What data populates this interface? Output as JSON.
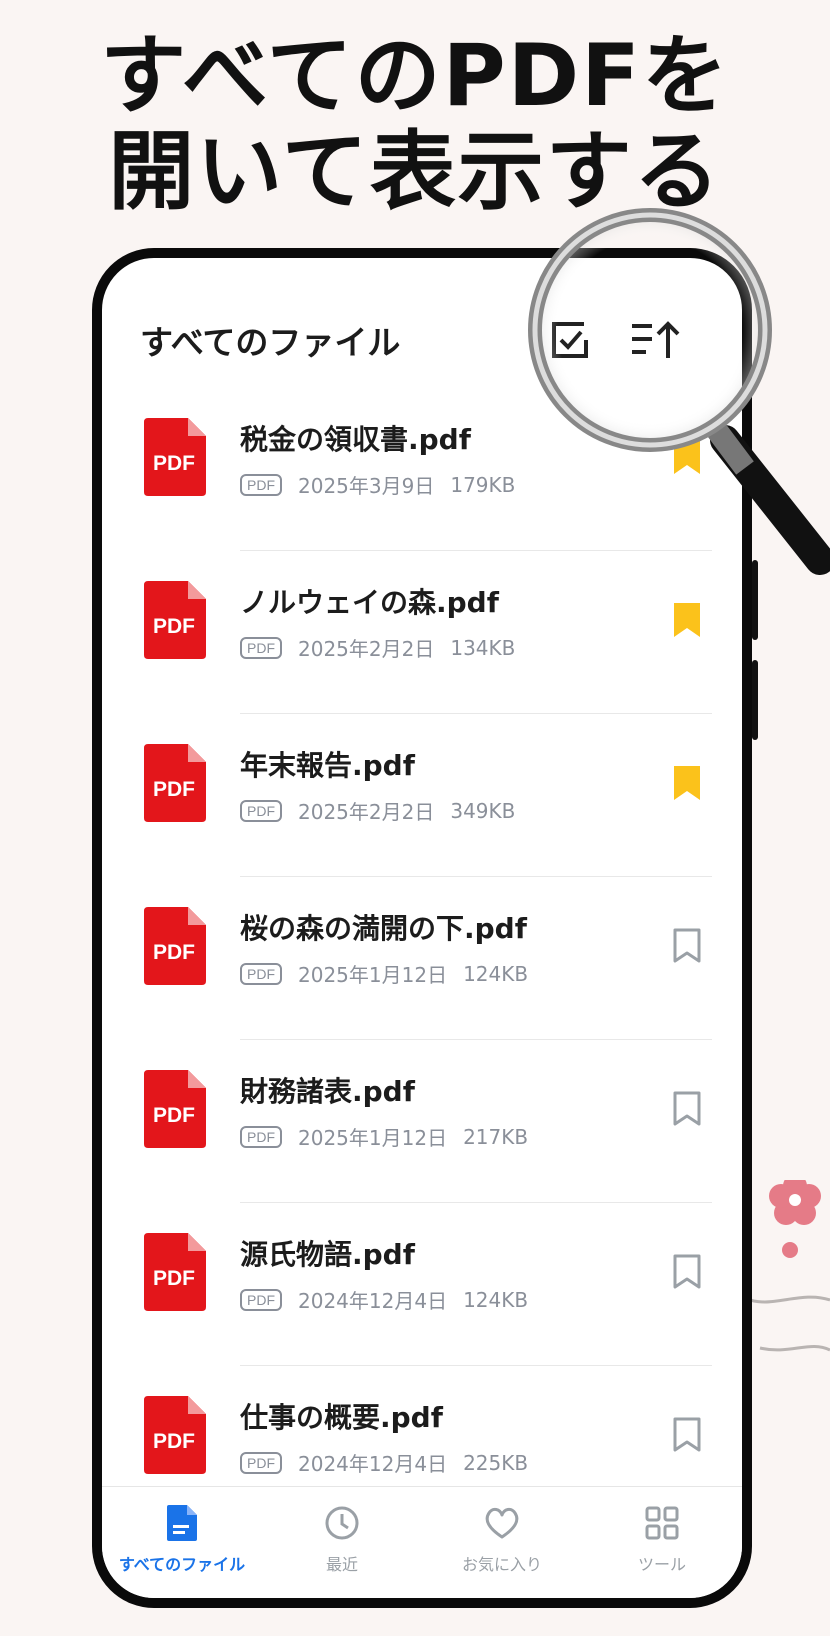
{
  "headline": {
    "line1": "すべてのPDFを",
    "line2": "開いて表示する"
  },
  "header": {
    "title": "すべてのファイル",
    "select_icon": "checkbox-select-icon",
    "sort_icon": "sort-ascending-icon"
  },
  "colors": {
    "pdf_red": "#e3161b",
    "bookmark_yellow": "#fbc21b",
    "accent_blue": "#1a73e8",
    "muted_gray": "#8a8f99"
  },
  "files": [
    {
      "name": "税金の領収書.pdf",
      "badge": "PDF",
      "date": "2025年3月9日",
      "size": "179KB",
      "bookmarked": true
    },
    {
      "name": "ノルウェイの森.pdf",
      "badge": "PDF",
      "date": "2025年2月2日",
      "size": "134KB",
      "bookmarked": true
    },
    {
      "name": "年末報告.pdf",
      "badge": "PDF",
      "date": "2025年2月2日",
      "size": "349KB",
      "bookmarked": true
    },
    {
      "name": "桜の森の満開の下.pdf",
      "badge": "PDF",
      "date": "2025年1月12日",
      "size": "124KB",
      "bookmarked": false
    },
    {
      "name": "財務諸表.pdf",
      "badge": "PDF",
      "date": "2025年1月12日",
      "size": "217KB",
      "bookmarked": false
    },
    {
      "name": "源氏物語.pdf",
      "badge": "PDF",
      "date": "2024年12月4日",
      "size": "124KB",
      "bookmarked": false
    },
    {
      "name": "仕事の概要.pdf",
      "badge": "PDF",
      "date": "2024年12月4日",
      "size": "225KB",
      "bookmarked": false
    }
  ],
  "pdf_icon_label": "PDF",
  "tabs": [
    {
      "label": "すべてのファイル",
      "icon": "document-icon",
      "active": true
    },
    {
      "label": "最近",
      "icon": "clock-icon",
      "active": false
    },
    {
      "label": "お気に入り",
      "icon": "heart-icon",
      "active": false
    },
    {
      "label": "ツール",
      "icon": "grid-icon",
      "active": false
    }
  ]
}
